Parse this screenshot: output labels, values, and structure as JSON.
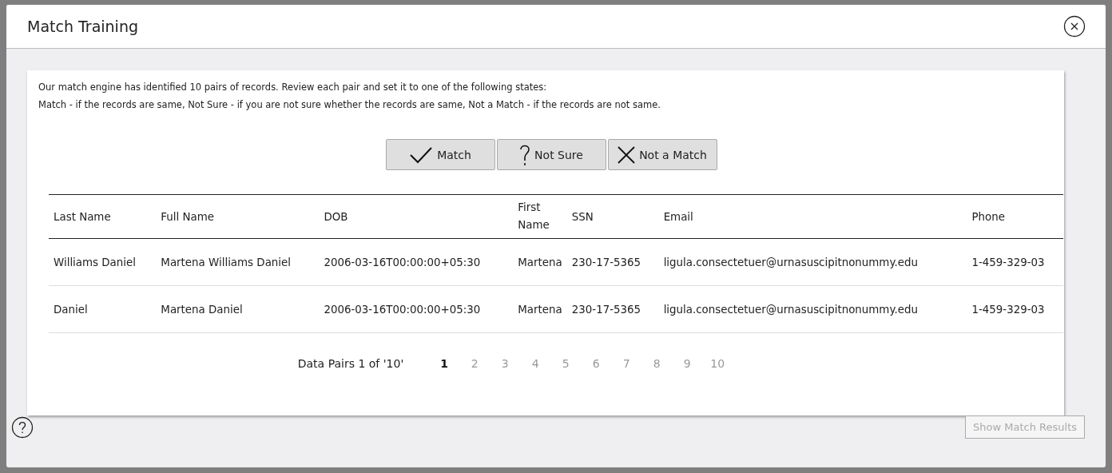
{
  "dialog": {
    "title": "Match Training"
  },
  "intro": [
    "Our match engine has identified 10 pairs of records. Review each pair and set it to one of the following states:",
    "Match - if the records are same, Not Sure - if you are not sure whether the records are same, Not a Match - if the records are not same."
  ],
  "actions": [
    {
      "kind": "check",
      "label": "Match"
    },
    {
      "kind": "question",
      "label": "Not Sure"
    },
    {
      "kind": "cross",
      "label": "Not a Match"
    }
  ],
  "table": {
    "columns": [
      "Last Name",
      "Full Name",
      "DOB",
      "First Name",
      "SSN",
      "Email",
      "Phone"
    ],
    "rows": [
      [
        "Williams Daniel",
        "Martena Williams Daniel",
        "2006-03-16T00:00:00+05:30",
        "Martena",
        "230-17-5365",
        "ligula.consectetuer@urnasuscipitnonummy.edu",
        "1-459-329-03"
      ],
      [
        "Daniel",
        "Martena Daniel",
        "2006-03-16T00:00:00+05:30",
        "Martena",
        "230-17-5365",
        "ligula.consectetuer@urnasuscipitnonummy.edu",
        "1-459-329-03"
      ]
    ]
  },
  "pagination": {
    "label": "Data Pairs 1 of '10'",
    "pages": [
      {
        "label": "1",
        "selected": true
      },
      {
        "label": "2",
        "selected": false
      },
      {
        "label": "3",
        "selected": false
      },
      {
        "label": "4",
        "selected": false
      },
      {
        "label": "5",
        "selected": false
      },
      {
        "label": "6",
        "selected": false
      },
      {
        "label": "7",
        "selected": false
      },
      {
        "label": "8",
        "selected": false
      },
      {
        "label": "9",
        "selected": false
      },
      {
        "label": "10",
        "selected": false
      }
    ]
  },
  "footer": {
    "button": {
      "label": "Show Match Results",
      "disabled": true
    }
  }
}
